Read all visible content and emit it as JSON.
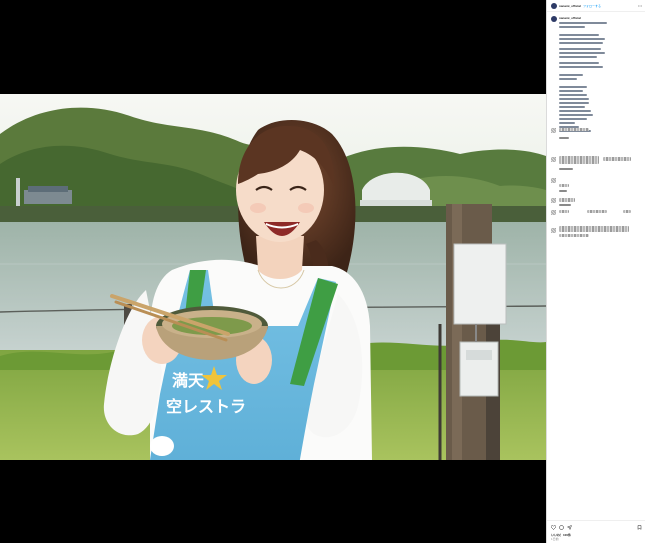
{
  "post": {
    "username": "nanami_official",
    "follow_label": "フォローする",
    "photo_sign_line1": "満天",
    "photo_sign_line2": "空レストラ"
  },
  "caption": {
    "username": "nanami_official",
    "date": "1日前"
  },
  "footer": {
    "likes": "いいね！100件",
    "date": "1日前"
  },
  "colors": {
    "sky": "#f3f6ef",
    "hills": "#4f6e34",
    "water": "#a8b8b1",
    "grass": "#8dae4c",
    "apron": "#6ab7dc",
    "apron_strap": "#3f9e44",
    "star": "#f0c43a",
    "link": "#0095f6"
  },
  "icons": [
    "heart-icon",
    "comment-icon",
    "share-icon",
    "bookmark-icon",
    "more-icon"
  ]
}
